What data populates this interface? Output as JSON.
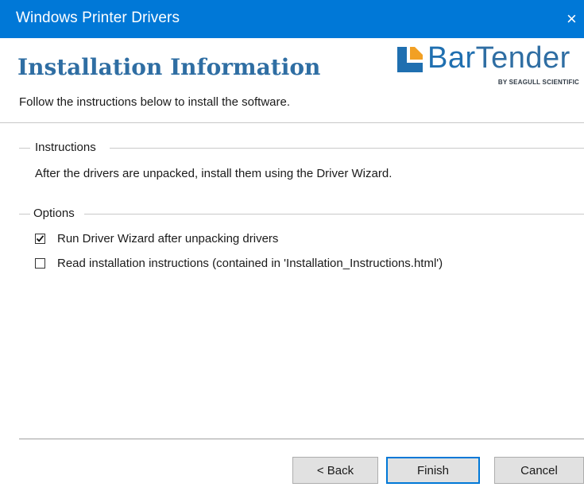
{
  "window": {
    "title": "Windows Printer Drivers",
    "close_glyph": "×"
  },
  "header": {
    "title": "Installation Information",
    "subtitle": "Follow the instructions below to install the software.",
    "logo": {
      "word_part1": "Bar",
      "word_part2": "Tender",
      "tagline": "BY SEAGULL SCIENTIFIC",
      "colors": {
        "mark": "#1f6fb0",
        "word": "#2f6ea3"
      }
    }
  },
  "instructions": {
    "group_label": "Instructions",
    "text": "After the drivers are unpacked, install them using the Driver Wizard."
  },
  "options": {
    "group_label": "Options",
    "items": [
      {
        "label": "Run Driver Wizard after unpacking drivers",
        "checked": true
      },
      {
        "label": "Read installation instructions (contained in 'Installation_Instructions.html')",
        "checked": false
      }
    ]
  },
  "buttons": {
    "back": "< Back",
    "finish": "Finish",
    "cancel": "Cancel"
  },
  "colors": {
    "titlebar": "#0078d7",
    "title_text": "#2f6ea3",
    "button_bg": "#e1e1e1",
    "default_border": "#0078d7"
  }
}
